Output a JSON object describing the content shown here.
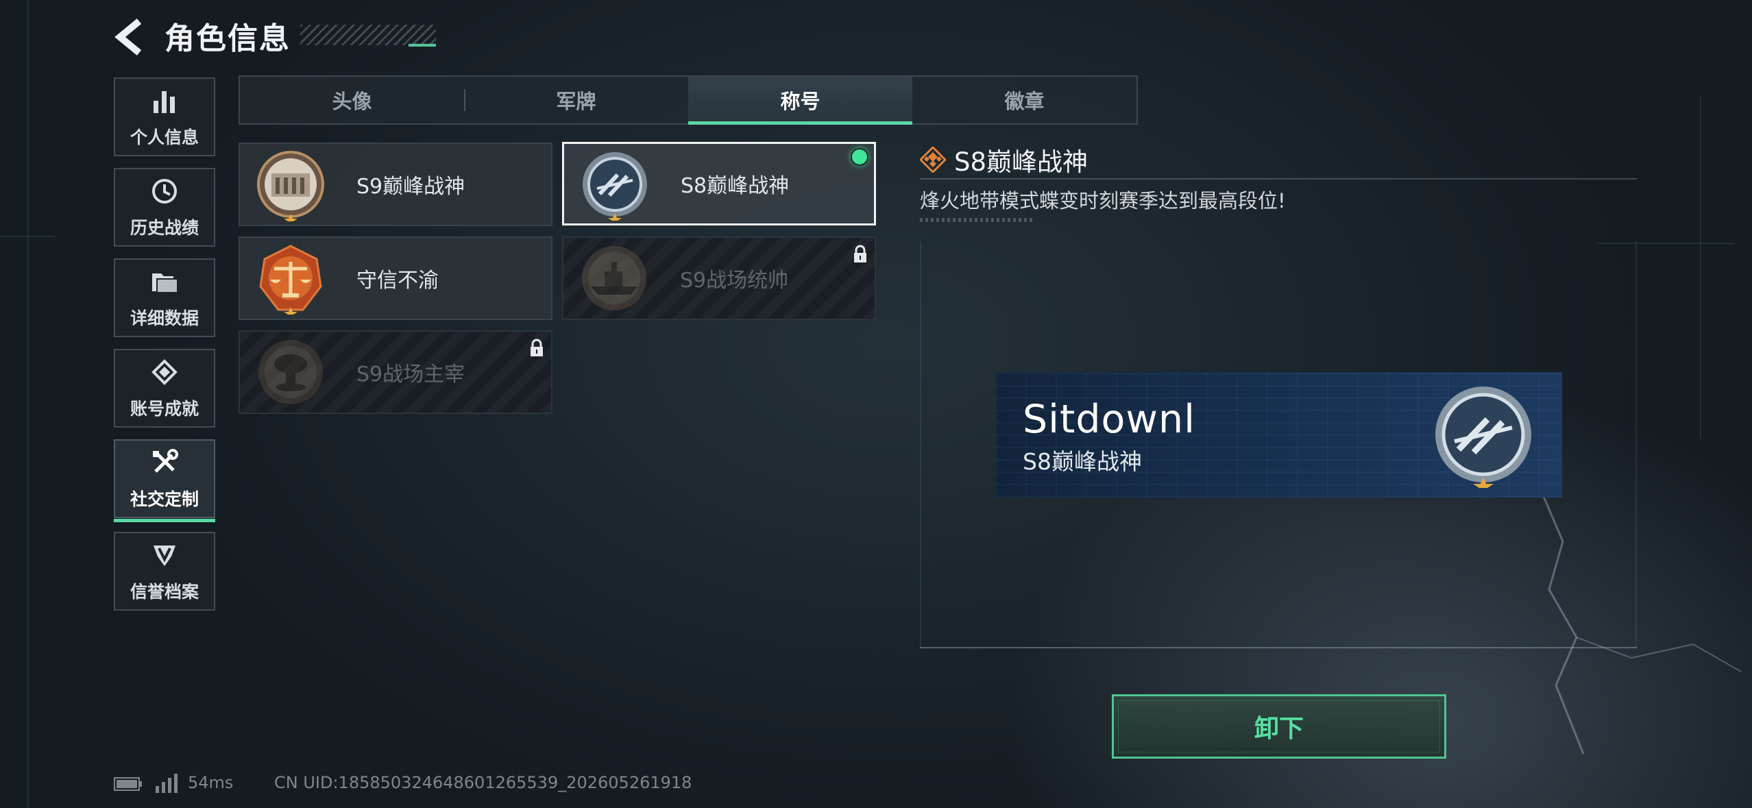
{
  "header": {
    "title": "角色信息",
    "back_icon": "back-arrow-icon"
  },
  "sidebar": {
    "items": [
      {
        "label": "个人信息",
        "icon": "bar-chart-icon",
        "active": false
      },
      {
        "label": "历史战绩",
        "icon": "history-clock-icon",
        "active": false
      },
      {
        "label": "详细数据",
        "icon": "folder-icon",
        "active": false
      },
      {
        "label": "账号成就",
        "icon": "achievement-icon",
        "active": false
      },
      {
        "label": "社交定制",
        "icon": "tools-icon",
        "active": true
      },
      {
        "label": "信誉档案",
        "icon": "reputation-icon",
        "active": false
      }
    ]
  },
  "tabs": [
    {
      "label": "头像",
      "active": false
    },
    {
      "label": "军牌",
      "active": false
    },
    {
      "label": "称号",
      "active": true
    },
    {
      "label": "徽章",
      "active": false
    }
  ],
  "titles": [
    {
      "name": "S9巅峰战神",
      "emblem": "fortress-emblem-icon",
      "locked": false,
      "selected": false,
      "equipped": false
    },
    {
      "name": "S8巅峰战神",
      "emblem": "s8-laurel-emblem-icon",
      "locked": false,
      "selected": true,
      "equipped": true
    },
    {
      "name": "守信不渝",
      "emblem": "scales-emblem-icon",
      "locked": false,
      "selected": false,
      "equipped": false
    },
    {
      "name": "S9战场统帅",
      "emblem": "warship-emblem-icon",
      "locked": true,
      "selected": false,
      "equipped": false
    },
    {
      "name": "S9战场主宰",
      "emblem": "mushroom-cloud-emblem-icon",
      "locked": true,
      "selected": false,
      "equipped": false
    }
  ],
  "detail": {
    "title": "S8巅峰战神",
    "title_icon": "diamond-grid-icon",
    "description": "烽火地带模式蝶变时刻赛季达到最高段位!"
  },
  "nameplate": {
    "player_name": "Sitdownl",
    "title": "S8巅峰战神",
    "emblem": "s8-laurel-emblem-icon"
  },
  "actions": {
    "unequip_label": "卸下"
  },
  "status": {
    "ping": "54ms",
    "uid": "CN UID:18585032464860126553​9_202605261918"
  },
  "colors": {
    "accent": "#5bd6a4",
    "equipped": "#3fe59a",
    "nameplate_bg": "#183152"
  }
}
